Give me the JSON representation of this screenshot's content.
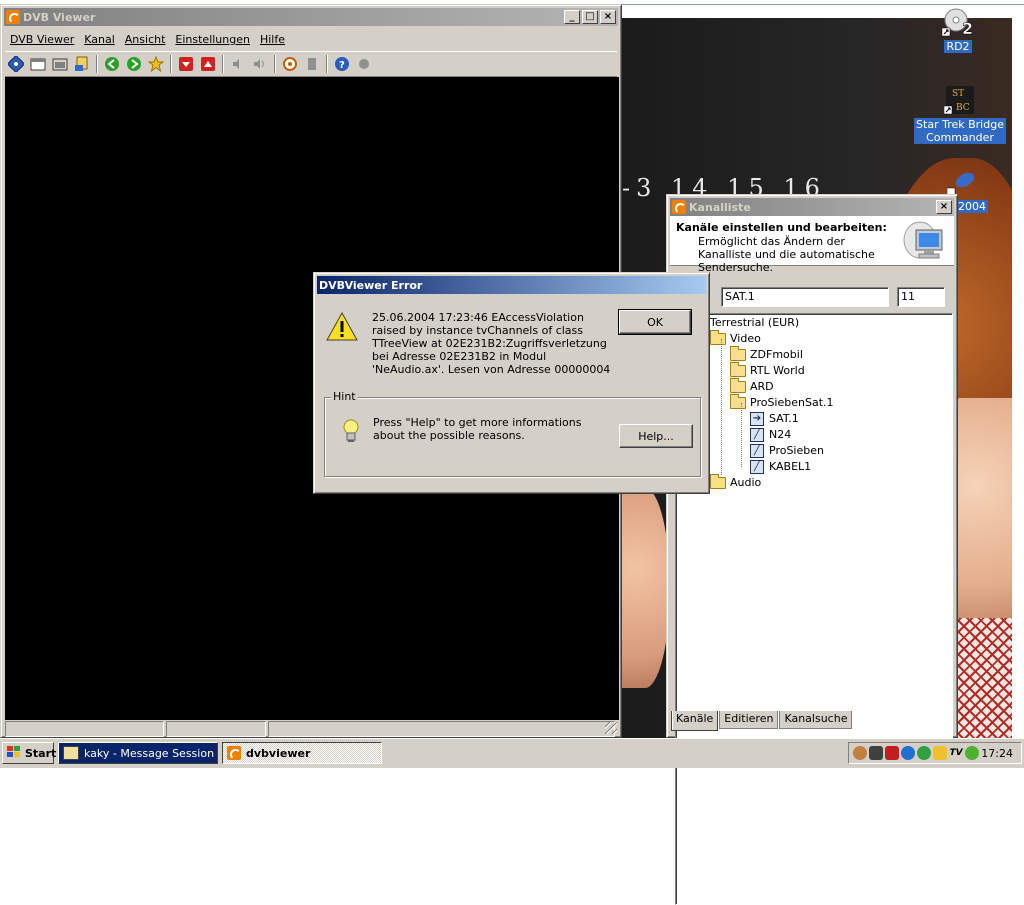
{
  "desktop": {
    "wallpaper_digits": "-3 14 15 16",
    "icons": [
      {
        "label": "RD2"
      },
      {
        "label": "Star Trek Bridge Commander"
      },
      {
        "label": "2004"
      }
    ]
  },
  "dvbviewer": {
    "title": "DVB Viewer",
    "menu": [
      "DVB Viewer",
      "Kanal",
      "Ansicht",
      "Einstellungen",
      "Hilfe"
    ],
    "caption_buttons": [
      "_",
      "□",
      "×"
    ]
  },
  "kanalliste": {
    "title": "Kanalliste",
    "header_title": "Kanäle einstellen und bearbeiten:",
    "header_desc": "Ermöglicht das Ändern der Kanalliste und die automatische Sendersuche.",
    "name_value": "SAT.1",
    "number_value": "11",
    "tree": {
      "root": "Terrestrial (EUR)",
      "video": "Video",
      "folders": [
        "ZDFmobil",
        "RTL World",
        "ARD",
        "ProSiebenSat.1"
      ],
      "channels": [
        "SAT.1",
        "N24",
        "ProSieben",
        "KABEL1"
      ],
      "audio": "Audio"
    },
    "tabs": [
      "Kanäle",
      "Editieren",
      "Kanalsuche"
    ]
  },
  "error_dialog": {
    "title": "DVBViewer Error",
    "message": "25.06.2004 17:23:46 EAccessViolation raised by instance tvChannels of class TTreeView at 02E231B2:Zugriffsverletzung bei Adresse 02E231B2 in Modul 'NeAudio.ax'. Lesen von Adresse 00000004",
    "ok_label": "OK",
    "hint_label": "Hint",
    "hint_text": "Press \"Help\" to get more informations about the possible reasons.",
    "help_label": "Help..."
  },
  "taskbar": {
    "start_label": "Start",
    "tasks": [
      {
        "label": "kaky - Message Session"
      },
      {
        "label": "dvbviewer"
      }
    ],
    "clock": "17:24"
  }
}
